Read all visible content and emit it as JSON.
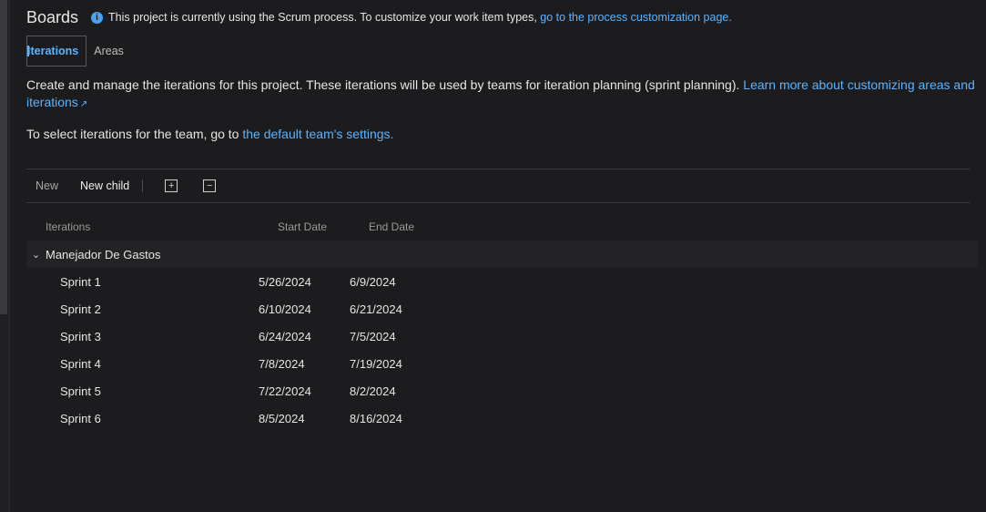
{
  "header": {
    "title": "Boards",
    "info_text": "This project is currently using the Scrum process. To customize your work item types, ",
    "info_link": "go to the process customization page."
  },
  "tabs": [
    {
      "label": "Iterations",
      "active": true
    },
    {
      "label": "Areas",
      "active": false
    }
  ],
  "description": {
    "text": "Create and manage the iterations for this project. These iterations will be used by teams for iteration planning (sprint planning). ",
    "link": "Learn more about customizing areas and iterations"
  },
  "select_line": {
    "text": "To select iterations for the team, go to ",
    "link": "the default team's settings."
  },
  "toolbar": {
    "new_label": "New",
    "new_child_label": "New child",
    "expand_icon": "expand-all-icon",
    "collapse_icon": "collapse-all-icon"
  },
  "grid": {
    "columns": [
      "Iterations",
      "Start Date",
      "End Date"
    ],
    "parent": {
      "name": "Manejador De Gastos",
      "expanded": true
    },
    "rows": [
      {
        "name": "Sprint 1",
        "start": "5/26/2024",
        "end": "6/9/2024"
      },
      {
        "name": "Sprint 2",
        "start": "6/10/2024",
        "end": "6/21/2024"
      },
      {
        "name": "Sprint 3",
        "start": "6/24/2024",
        "end": "7/5/2024"
      },
      {
        "name": "Sprint 4",
        "start": "7/8/2024",
        "end": "7/19/2024"
      },
      {
        "name": "Sprint 5",
        "start": "7/22/2024",
        "end": "8/2/2024"
      },
      {
        "name": "Sprint 6",
        "start": "8/5/2024",
        "end": "8/16/2024"
      }
    ]
  },
  "colors": {
    "accent": "#5cb3ff",
    "background": "#1c1c1e"
  }
}
